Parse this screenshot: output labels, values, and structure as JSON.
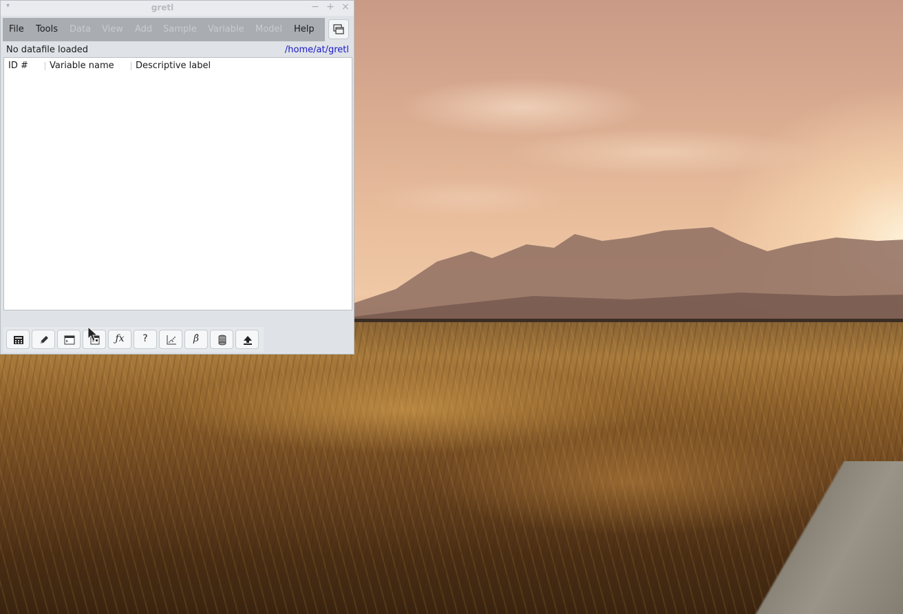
{
  "window": {
    "title": "gretl",
    "menu": {
      "file": "File",
      "tools": "Tools",
      "data": "Data",
      "view": "View",
      "add": "Add",
      "sample": "Sample",
      "variable": "Variable",
      "model": "Model",
      "help": "Help"
    },
    "status": "No datafile loaded",
    "working_dir": "/home/at/gretl",
    "columns": {
      "id": "ID #",
      "varname": "Variable name",
      "label": "Descriptive label"
    },
    "toolbar": {
      "fx_glyph": "ƒx",
      "help_glyph": "?",
      "beta_glyph": "β̂"
    }
  },
  "colors": {
    "menubar_bg": "#a9adb2",
    "disabled_text": "#c8cbcf",
    "link": "#1818c8"
  }
}
